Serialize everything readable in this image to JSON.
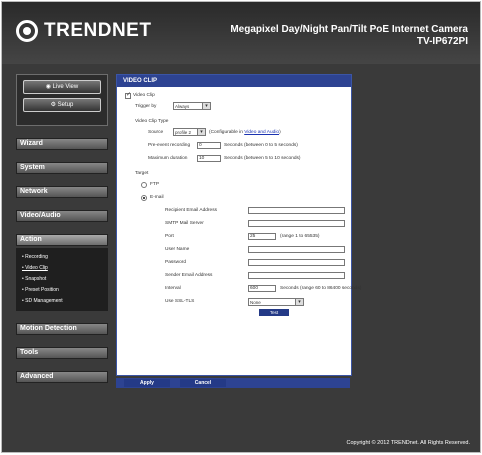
{
  "header": {
    "logo_text": "TRENDNET",
    "product_line1": "Megapixel Day/Night Pan/Tilt PoE Internet Camera",
    "product_line2": "TV-IP672PI"
  },
  "sidebar": {
    "live_view": "Live View",
    "setup": "Setup",
    "items": [
      "Wizard",
      "System",
      "Network",
      "Video/Audio",
      "Action",
      "Motion Detection",
      "Tools",
      "Advanced"
    ],
    "action_submenu": [
      "• Recording",
      "• Video Clip",
      "• Snapshot",
      "• Preset Position",
      "• SD Management"
    ]
  },
  "panel": {
    "title": "VIDEO CLIP",
    "video_clip_label": "Video Clip",
    "trigger_by_label": "Trigger by",
    "trigger_by_value": "Always",
    "video_clip_type_label": "Video Clip Type",
    "source_label": "Source",
    "source_value": "profile 2",
    "configurable_text": "(Configurable in ",
    "configurable_link": "Video and Audio",
    "configurable_end": ")",
    "pre_event_label": "Pre-event recording",
    "pre_event_value": "0",
    "pre_event_hint": "Seconds  (between 0 to 5 seconds)",
    "max_duration_label": "Maximum duration",
    "max_duration_value": "10",
    "max_duration_hint": "Seconds  (between 5 to 10 seconds)",
    "target_label": "Target",
    "ftp_label": "FTP",
    "email_label": "E-mail",
    "recipient_label": "Recipient Email Address",
    "smtp_label": "SMTP Mail Server",
    "port_label": "Port",
    "port_value": "25",
    "port_hint": "(range 1 to 65535)",
    "username_label": "User Name",
    "password_label": "Password",
    "sender_label": "Sender Email Address",
    "interval_label": "Interval",
    "interval_value": "600",
    "interval_hint": "Seconds  (range 60 to 86400 seconds)",
    "ssl_label": "Use SSL-TLS",
    "ssl_value": "None",
    "test_button": "Test"
  },
  "actions": {
    "apply": "Apply",
    "cancel": "Cancel"
  },
  "footer": {
    "copyright": "Copyright © 2012 TRENDnet. All Rights Reserved."
  }
}
